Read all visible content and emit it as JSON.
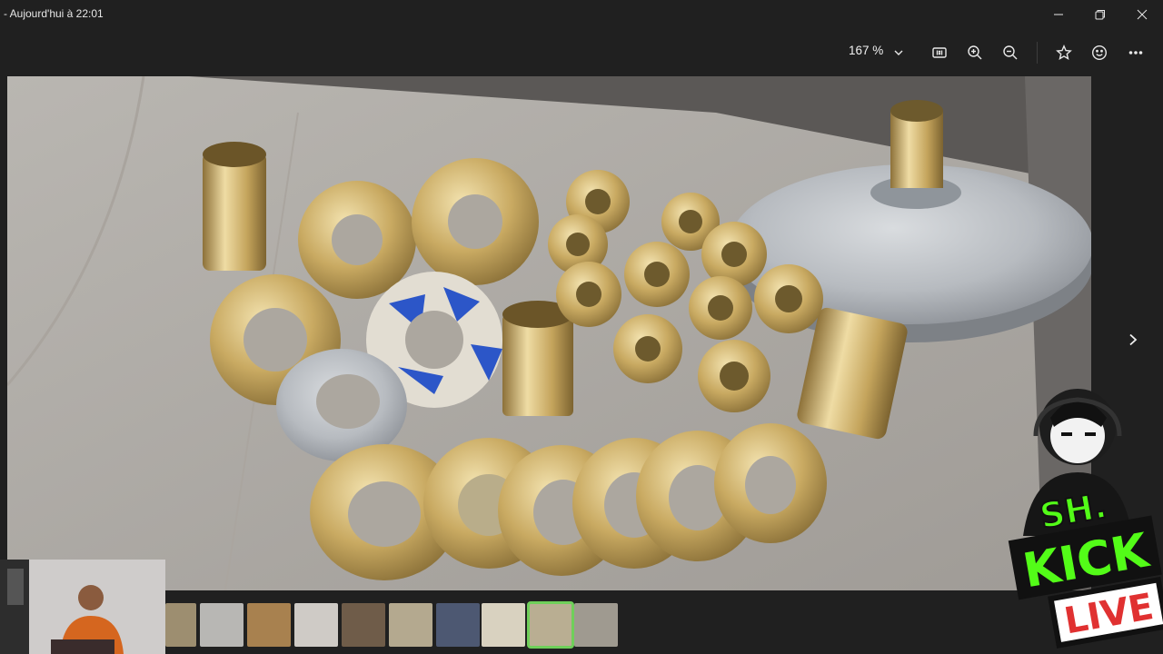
{
  "window": {
    "title": "- Aujourd'hui à 22:01",
    "controls": [
      "minimize-icon",
      "restore-icon",
      "close-icon"
    ]
  },
  "toolbar": {
    "zoom_value": "167 %",
    "buttons": [
      "zoom-dropdown-icon",
      "actual-size-icon",
      "zoom-in-icon",
      "zoom-out-icon",
      "favorite-star-icon",
      "feedback-smile-icon",
      "more-options-icon"
    ]
  },
  "viewer": {
    "next_button": "chevron-right-icon"
  },
  "filmstrip": {
    "thumbnail_count": 10,
    "selected_index": 8
  },
  "overlay": {
    "badge_top": "SH.",
    "badge_kick": "KICK",
    "badge_live": "LIVE",
    "accent_color": "#53fc18"
  }
}
